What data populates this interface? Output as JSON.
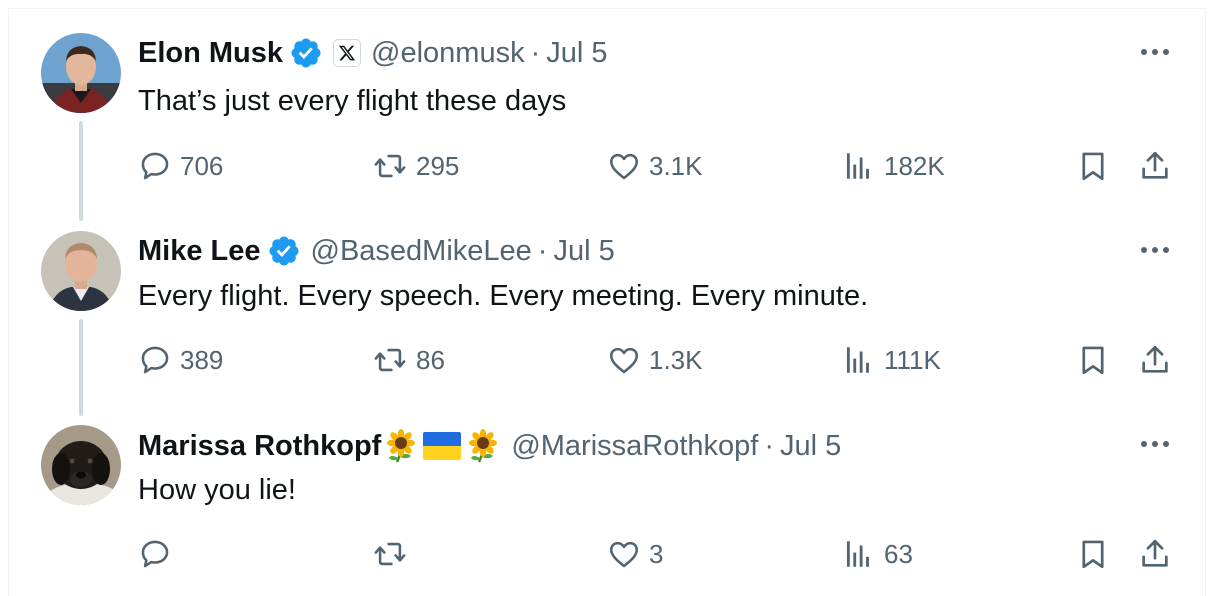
{
  "tweets": [
    {
      "name": "Elon Musk",
      "handle": "@elonmusk",
      "separator": "·",
      "date": "Jul 5",
      "text": "That’s just every flight these days",
      "verified_badge": "verified-checkmark-icon",
      "org_badge": "x-logo-icon",
      "stats": {
        "replies": "706",
        "reposts": "295",
        "likes": "3.1K",
        "views": "182K"
      }
    },
    {
      "name": "Mike Lee",
      "handle": "@BasedMikeLee",
      "separator": "·",
      "date": "Jul 5",
      "text": "Every flight. Every speech. Every meeting. Every minute.",
      "verified_badge": "verified-checkmark-icon",
      "stats": {
        "replies": "389",
        "reposts": "86",
        "likes": "1.3K",
        "views": "111K"
      }
    },
    {
      "name": "Marissa Rothkopf",
      "name_emojis": [
        "sunflower-icon",
        "ukraine-flag-icon",
        "sunflower-icon"
      ],
      "handle": "@MarissaRothkopf",
      "separator": "·",
      "date": "Jul 5",
      "text": "How you lie!",
      "stats": {
        "replies": "",
        "reposts": "",
        "likes": "3",
        "views": "63"
      }
    }
  ],
  "colors": {
    "verified": "#1d9bf0",
    "secondary_text": "#536471",
    "thread_line": "#cfd9de"
  }
}
